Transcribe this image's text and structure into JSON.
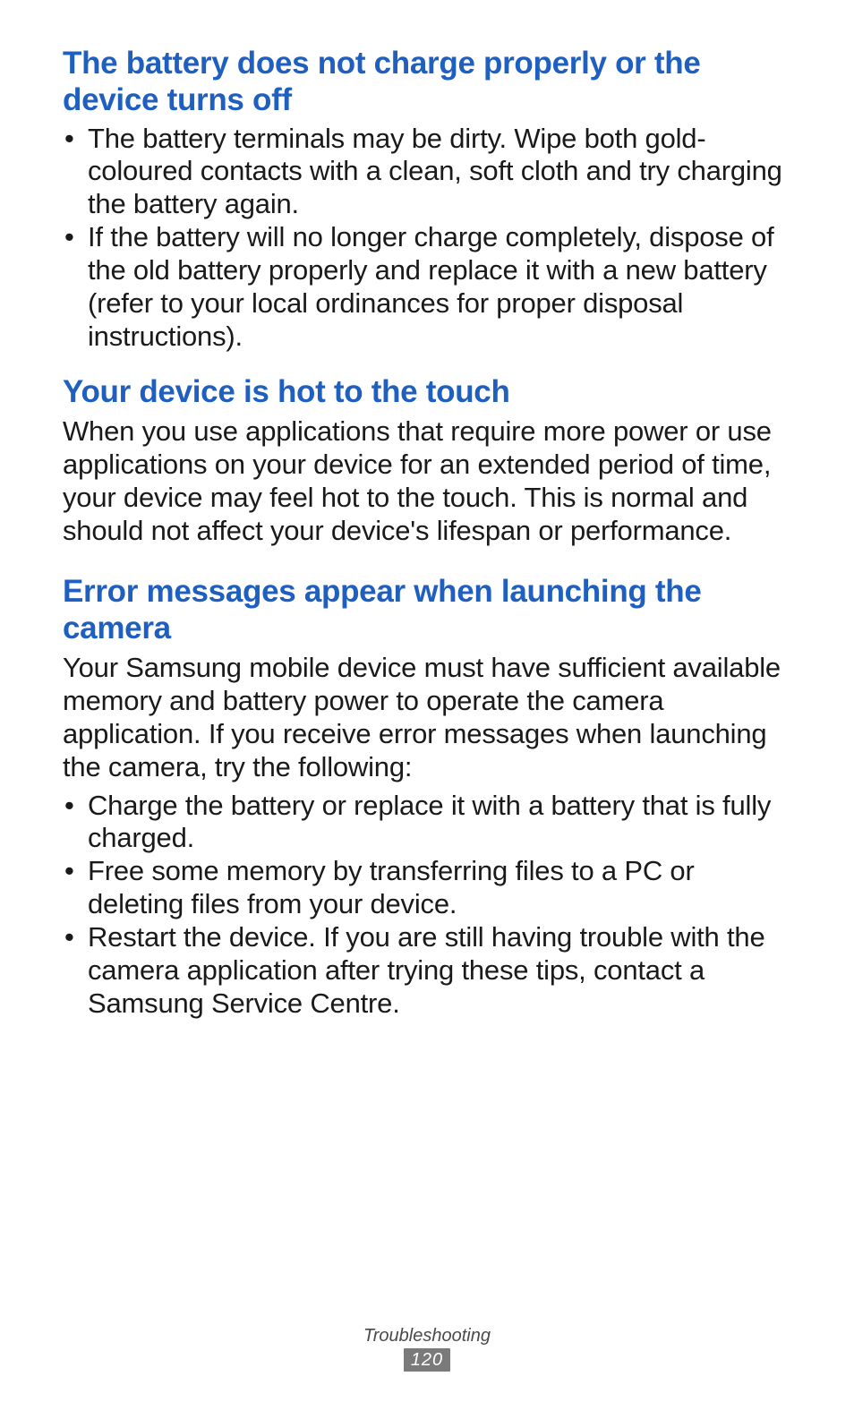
{
  "sections": [
    {
      "heading": "The battery does not charge properly or the device turns off",
      "paragraphs": [],
      "bullets": [
        "The battery terminals may be dirty. Wipe both gold-coloured contacts with a clean, soft cloth and try charging the battery again.",
        "If the battery will no longer charge completely, dispose of the old battery properly and replace it with a new battery (refer to your local ordinances for proper disposal instructions)."
      ]
    },
    {
      "heading": "Your device is hot to the touch",
      "paragraphs": [
        "When you use applications that require more power or use applications on your device for an extended period of time, your device may feel hot to the touch. This is normal and should not affect your device's lifespan or performance."
      ],
      "bullets": []
    },
    {
      "heading": "Error messages appear when launching the camera",
      "paragraphs": [
        "Your Samsung mobile device must have sufficient available memory and battery power to operate the camera application. If you receive error messages when launching the camera, try the following:"
      ],
      "bullets": [
        "Charge the battery or replace it with a battery that is fully charged.",
        "Free some memory by transferring files to a PC or deleting files from your device.",
        "Restart the device. If you are still having trouble with the camera application after trying these tips, contact a Samsung Service Centre."
      ]
    }
  ],
  "footer": {
    "section_name": "Troubleshooting",
    "page_number": "120"
  }
}
